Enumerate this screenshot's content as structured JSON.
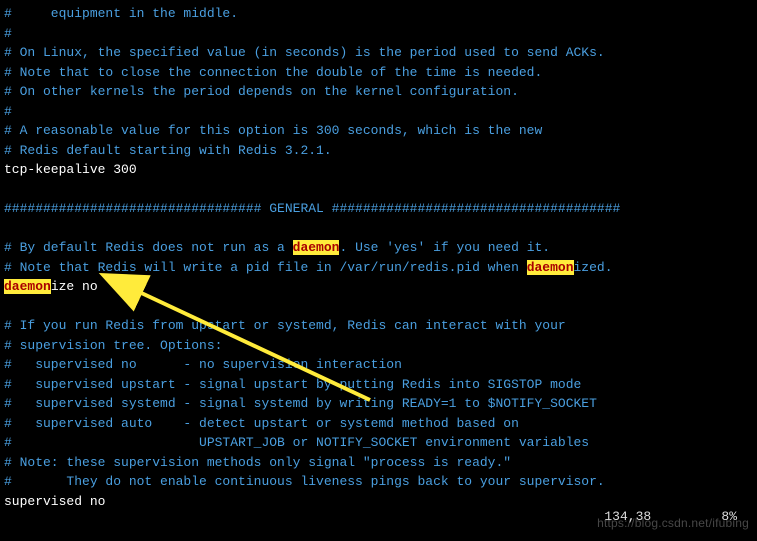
{
  "lines": [
    {
      "t": "#     equipment in the middle.",
      "c": "blue"
    },
    {
      "t": "#",
      "c": "blue"
    },
    {
      "t": "# On Linux, the specified value (in seconds) is the period used to send ACKs.",
      "c": "blue"
    },
    {
      "t": "# Note that to close the connection the double of the time is needed.",
      "c": "blue"
    },
    {
      "t": "# On other kernels the period depends on the kernel configuration.",
      "c": "blue"
    },
    {
      "t": "#",
      "c": "blue"
    },
    {
      "t": "# A reasonable value for this option is 300 seconds, which is the new",
      "c": "blue"
    },
    {
      "t": "# Redis default starting with Redis 3.2.1.",
      "c": "blue"
    },
    {
      "t": "tcp-keepalive 300",
      "c": "white"
    },
    {
      "t": "",
      "c": "blue"
    },
    {
      "t": "################################# GENERAL #####################################",
      "c": "blue"
    },
    {
      "t": "",
      "c": "blue"
    },
    {
      "segments": [
        {
          "t": "# By default Redis does not run as a ",
          "c": "blue"
        },
        {
          "t": "daemon",
          "c": "hl"
        },
        {
          "t": ". Use 'yes' if you need it.",
          "c": "blue"
        }
      ]
    },
    {
      "segments": [
        {
          "t": "# Note that Redis will write a pid file in /var/run/redis.pid when ",
          "c": "blue"
        },
        {
          "t": "daemon",
          "c": "hl"
        },
        {
          "t": "ized.",
          "c": "blue"
        }
      ]
    },
    {
      "segments": [
        {
          "t": "daemon",
          "c": "hl"
        },
        {
          "t": "ize no",
          "c": "white"
        }
      ]
    },
    {
      "t": "",
      "c": "blue"
    },
    {
      "t": "# If you run Redis from upstart or systemd, Redis can interact with your",
      "c": "blue"
    },
    {
      "t": "# supervision tree. Options:",
      "c": "blue"
    },
    {
      "t": "#   supervised no      - no supervision interaction",
      "c": "blue"
    },
    {
      "t": "#   supervised upstart - signal upstart by putting Redis into SIGSTOP mode",
      "c": "blue"
    },
    {
      "t": "#   supervised systemd - signal systemd by writing READY=1 to $NOTIFY_SOCKET",
      "c": "blue"
    },
    {
      "t": "#   supervised auto    - detect upstart or systemd method based on",
      "c": "blue"
    },
    {
      "t": "#                        UPSTART_JOB or NOTIFY_SOCKET environment variables",
      "c": "blue"
    },
    {
      "t": "# Note: these supervision methods only signal \"process is ready.\"",
      "c": "blue"
    },
    {
      "t": "#       They do not enable continuous liveness pings back to your supervisor.",
      "c": "blue"
    },
    {
      "t": "supervised no",
      "c": "white"
    }
  ],
  "status": "134,38         8%",
  "watermark": "https://blog.csdn.net/ifubing"
}
